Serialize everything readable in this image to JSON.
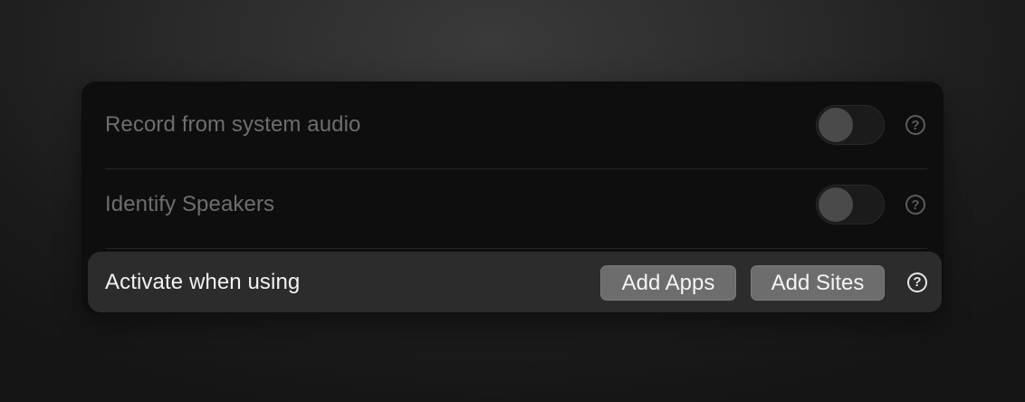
{
  "settings": {
    "system_audio": {
      "label": "Record from system audio",
      "enabled": false,
      "help_icon": "question-circle-icon"
    },
    "identify_speakers": {
      "label": "Identify Speakers",
      "enabled": false,
      "help_icon": "question-circle-icon"
    },
    "activate_when_using": {
      "label": "Activate when using",
      "add_apps_label": "Add Apps",
      "add_sites_label": "Add Sites",
      "help_icon": "question-circle-icon"
    }
  },
  "colors": {
    "panel_bg": "#0e0e0e",
    "active_row_bg": "#2c2c2c",
    "button_bg": "#6d6d6d",
    "disabled_text": "#6e6e6e",
    "active_text": "#f2f2f2"
  },
  "help_glyph": "?"
}
